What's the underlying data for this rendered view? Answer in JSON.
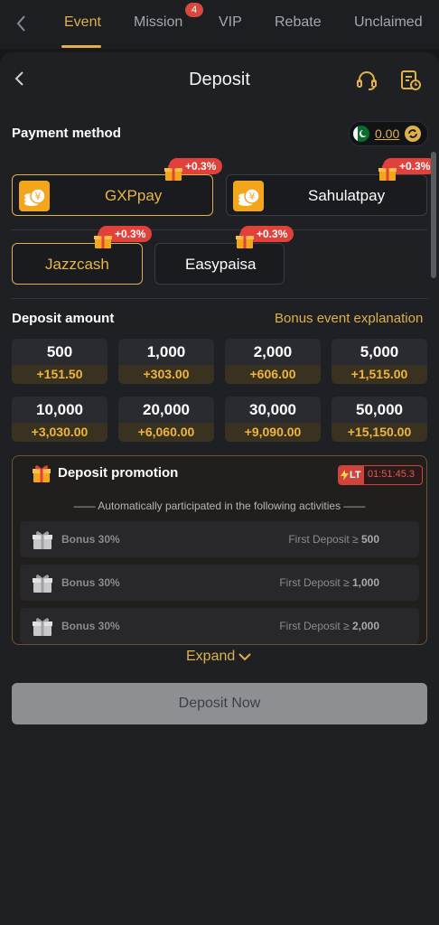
{
  "topnav": {
    "tabs": [
      "Event",
      "Mission",
      "VIP",
      "Rebate",
      "Unclaimed"
    ],
    "active_tab": "Event",
    "mission_badge": "4"
  },
  "header": {
    "title": "Deposit"
  },
  "payment": {
    "title": "Payment method",
    "balance": "0.00",
    "methods": [
      {
        "label": "GXPpay",
        "bonus": "+0.3%",
        "selected": true
      },
      {
        "label": "Sahulatpay",
        "bonus": "+0.3%",
        "selected": false
      },
      {
        "label": "Jazzcash",
        "bonus": "+0.3%",
        "selected": true
      },
      {
        "label": "Easypaisa",
        "bonus": "+0.3%",
        "selected": false
      }
    ]
  },
  "deposit": {
    "title": "Deposit amount",
    "bonus_link": "Bonus event explanation",
    "amounts": [
      {
        "value": "500",
        "bonus": "+151.50"
      },
      {
        "value": "1,000",
        "bonus": "+303.00"
      },
      {
        "value": "2,000",
        "bonus": "+606.00"
      },
      {
        "value": "5,000",
        "bonus": "+1,515.00"
      },
      {
        "value": "10,000",
        "bonus": "+3,030.00"
      },
      {
        "value": "20,000",
        "bonus": "+6,060.00"
      },
      {
        "value": "30,000",
        "bonus": "+9,090.00"
      },
      {
        "value": "50,000",
        "bonus": "+15,150.00"
      }
    ]
  },
  "promotion": {
    "title": "Deposit promotion",
    "lt_label": "LT",
    "timer": "01:51:45.3",
    "subtitle": "—— Automatically participated in the following activities ——",
    "items": [
      {
        "name": "Bonus 30%",
        "condition": "First Deposit ≥",
        "threshold": "500"
      },
      {
        "name": "Bonus 30%",
        "condition": "First Deposit ≥",
        "threshold": "1,000"
      },
      {
        "name": "Bonus 30%",
        "condition": "First Deposit ≥",
        "threshold": "2,000"
      }
    ],
    "expand_label": "Expand"
  },
  "actions": {
    "deposit_now": "Deposit Now"
  },
  "colors": {
    "accent": "#e0b04a",
    "badge": "#e0423b",
    "background": "#1f2024"
  },
  "icons": [
    "back-icon",
    "headset-icon",
    "history-icon",
    "flag-icon",
    "refresh-icon",
    "gift-icon",
    "coin-icon",
    "chevron-down-icon",
    "lightning-icon"
  ]
}
